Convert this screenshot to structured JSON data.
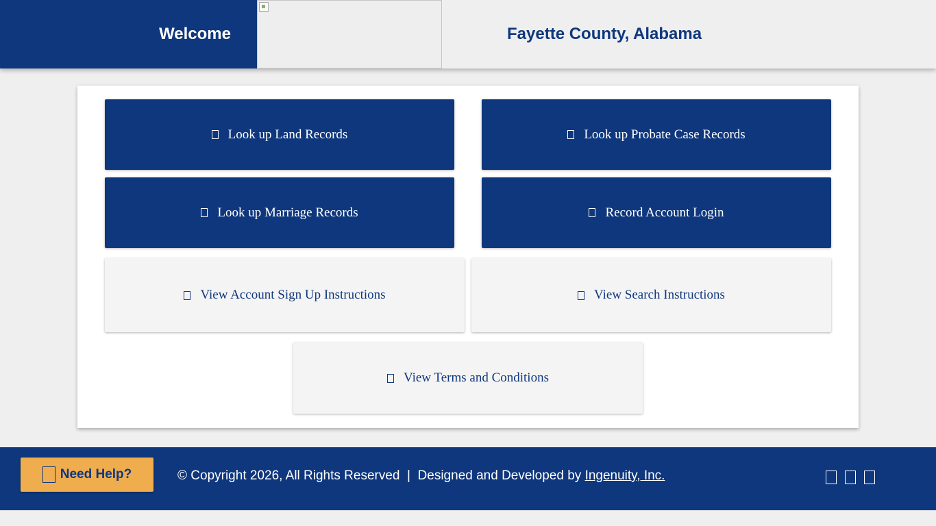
{
  "header": {
    "welcome": "Welcome",
    "county_title": "Fayette County, Alabama"
  },
  "buttons": {
    "land_records": "Look up Land Records",
    "probate_records": "Look up Probate Case Records",
    "marriage_records": "Look up Marriage Records",
    "account_login": "Record Account Login",
    "signup_instructions": "View Account Sign Up Instructions",
    "search_instructions": "View Search Instructions",
    "terms": "View Terms and Conditions"
  },
  "footer": {
    "help_label": "Need Help?",
    "copyright": "© Copyright 2026, All Rights Reserved  |  Designed and Developed by ",
    "developer_link": "Ingenuity, Inc."
  },
  "icons": {
    "land_records": "missing-glyph-icon",
    "probate_records": "missing-glyph-icon",
    "marriage_records": "missing-glyph-icon",
    "account_login": "missing-glyph-icon",
    "signup_instructions": "missing-glyph-icon",
    "search_instructions": "missing-glyph-icon",
    "terms": "missing-glyph-icon",
    "help": "missing-glyph-icon",
    "social": [
      "missing-glyph-icon",
      "missing-glyph-icon",
      "missing-glyph-icon"
    ]
  },
  "colors": {
    "brand_blue": "#0f377d",
    "help_orange": "#f0ad4e",
    "light_gray": "#f4f4f4"
  }
}
